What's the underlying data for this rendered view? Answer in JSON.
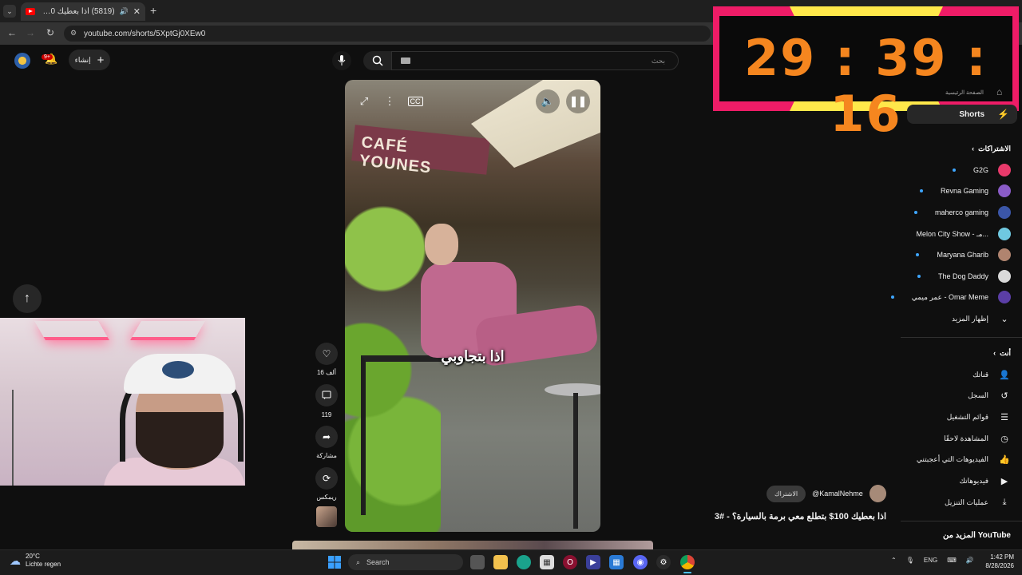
{
  "browser": {
    "tab_title": "(5819) اذا بعطيك 100$ بتطلع",
    "url": "youtube.com/shorts/5XptGj0XEw0"
  },
  "header": {
    "create_label": "إنشاء",
    "notification_badge": "9+",
    "search_placeholder": "بحث"
  },
  "video": {
    "caption": "اذا بتجاوبي",
    "sign_text": "CAFÉ YOUNES"
  },
  "actions": {
    "likes": "16 ألف",
    "comments": "119",
    "share": "مشاركة",
    "remix": "ريمكس"
  },
  "timer": {
    "display": "29 : 39 : 16"
  },
  "sidebar": {
    "home_label": "الصفحة الرئيسية",
    "shorts_label": "Shorts",
    "subscriptions_heading": "الاشتراكات",
    "channels": [
      {
        "name": "G2G",
        "color": "#e83a6b"
      },
      {
        "name": "Revna Gaming",
        "color": "#8a5cc7"
      },
      {
        "name": "maherco gaming",
        "color": "#3b56a8"
      },
      {
        "name": "Melon City Show - مـ...",
        "color": "#6fc8e0"
      },
      {
        "name": "Maryana Gharib",
        "color": "#b0846f"
      },
      {
        "name": "The Dog Daddy",
        "color": "#d9d9d9"
      },
      {
        "name": "عمر ميمي - Omar Meme",
        "color": "#5b3ea6"
      }
    ],
    "show_more": "إظهار المزيد",
    "you_heading": "أنت",
    "you_items": [
      {
        "label": "قناتك",
        "icon": "person-box-icon"
      },
      {
        "label": "السجل",
        "icon": "history-icon"
      },
      {
        "label": "قوائم التشغيل",
        "icon": "playlist-icon"
      },
      {
        "label": "المشاهدة لاحقًا",
        "icon": "clock-icon"
      },
      {
        "label": "الفيديوهات التي أعجبتني",
        "icon": "thumb-up-icon"
      },
      {
        "label": "فيديوهاتك",
        "icon": "play-box-icon"
      },
      {
        "label": "عمليات التنزيل",
        "icon": "download-icon"
      }
    ],
    "more_from": "المزيد من YouTube"
  },
  "channel": {
    "handle": "@KamalNehme",
    "subscribe_label": "الاشتراك",
    "title": "اذا بعطيك 100$ بتطلع معي برمة بالسيارة؟ - #3"
  },
  "taskbar": {
    "weather_temp": "20°C",
    "weather_desc": "Lichte regen",
    "search_label": "Search",
    "lang": "ENG",
    "time": "1:42 PM",
    "date": "8/28/2026"
  }
}
